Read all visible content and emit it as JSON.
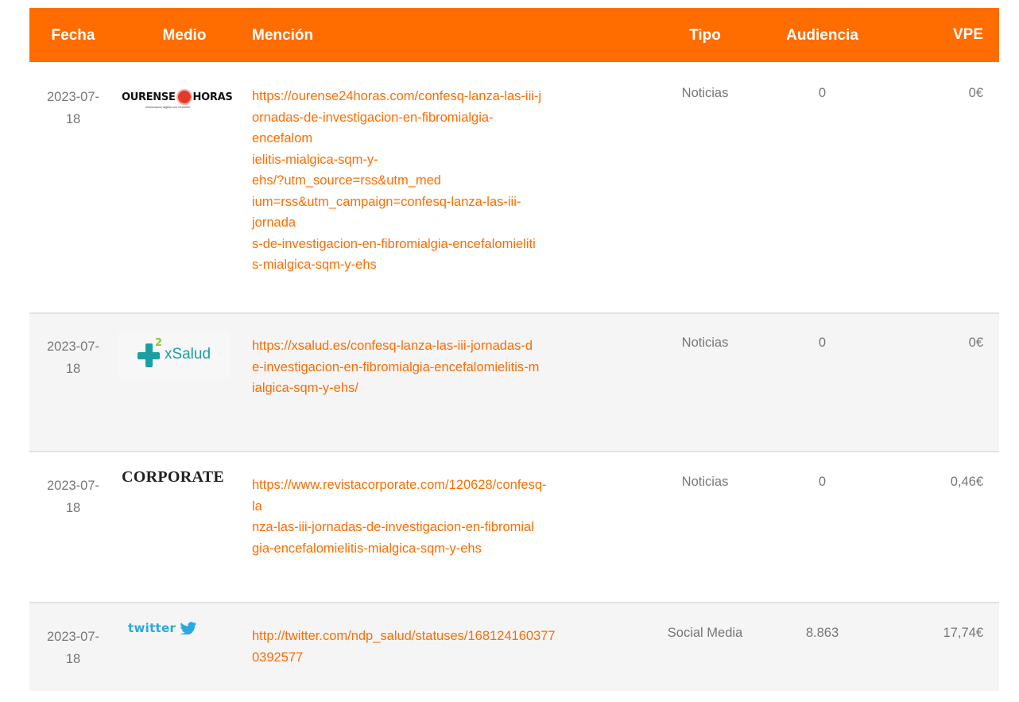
{
  "table": {
    "headers": {
      "fecha": "Fecha",
      "medio": "Medio",
      "mencion": "Mención",
      "tipo": "Tipo",
      "audiencia": "Audiencia",
      "vpe": "VPE"
    },
    "rows": [
      {
        "fecha": "2023-07-18",
        "medio_logo": {
          "name": "ourense-24-horas-logo",
          "text_left": "OURENSE",
          "text_right": "HORAS",
          "subtitle": "Información digital con Ourense"
        },
        "url_lines": [
          "https://ourense24horas.com/confesq-lanza-las-iii-j",
          "ornadas-de-investigacion-en-fibromialgia-",
          "encefalom",
          "ielitis-mialgica-sqm-y-",
          "ehs/?utm_source=rss&utm_med",
          "ium=rss&utm_campaign=confesq-lanza-las-iii-",
          "jornada",
          "s-de-investigacion-en-fibromialgia-encefalomieliti",
          "s-mialgica-sqm-y-ehs"
        ],
        "tipo": "Noticias",
        "audiencia": "0",
        "vpe": "0€"
      },
      {
        "fecha": "2023-07-18",
        "medio_logo": {
          "name": "xsalud-logo",
          "text": "xSalud",
          "superscript": "2"
        },
        "url_lines": [
          "https://xsalud.es/confesq-lanza-las-iii-jornadas-d",
          "e-investigacion-en-fibromialgia-encefalomielitis-m",
          "ialgica-sqm-y-ehs/"
        ],
        "tipo": "Noticias",
        "audiencia": "0",
        "vpe": "0€"
      },
      {
        "fecha": "2023-07-18",
        "medio_logo": {
          "name": "corporate-logo",
          "text": "CORPORATE"
        },
        "url_lines": [
          "https://www.revistacorporate.com/120628/confesq-",
          "la",
          "nza-las-iii-jornadas-de-investigacion-en-fibromial",
          "gia-encefalomielitis-mialgica-sqm-y-ehs"
        ],
        "tipo": "Noticias",
        "audiencia": "0",
        "vpe": "0,46€"
      },
      {
        "fecha": "2023-07-18",
        "medio_logo": {
          "name": "twitter-logo",
          "text": "twitter"
        },
        "url_lines": [
          "http://twitter.com/ndp_salud/statuses/168124160377",
          "0392577"
        ],
        "tipo": "Social Media",
        "audiencia": "8.863",
        "vpe": "17,74€"
      }
    ]
  },
  "colors": {
    "accent": "#ff6c00",
    "text_muted": "#777777",
    "row_alt": "#f5f5f5",
    "twitter_blue": "#28a9e0",
    "xsalud_teal": "#1aa0a3"
  }
}
